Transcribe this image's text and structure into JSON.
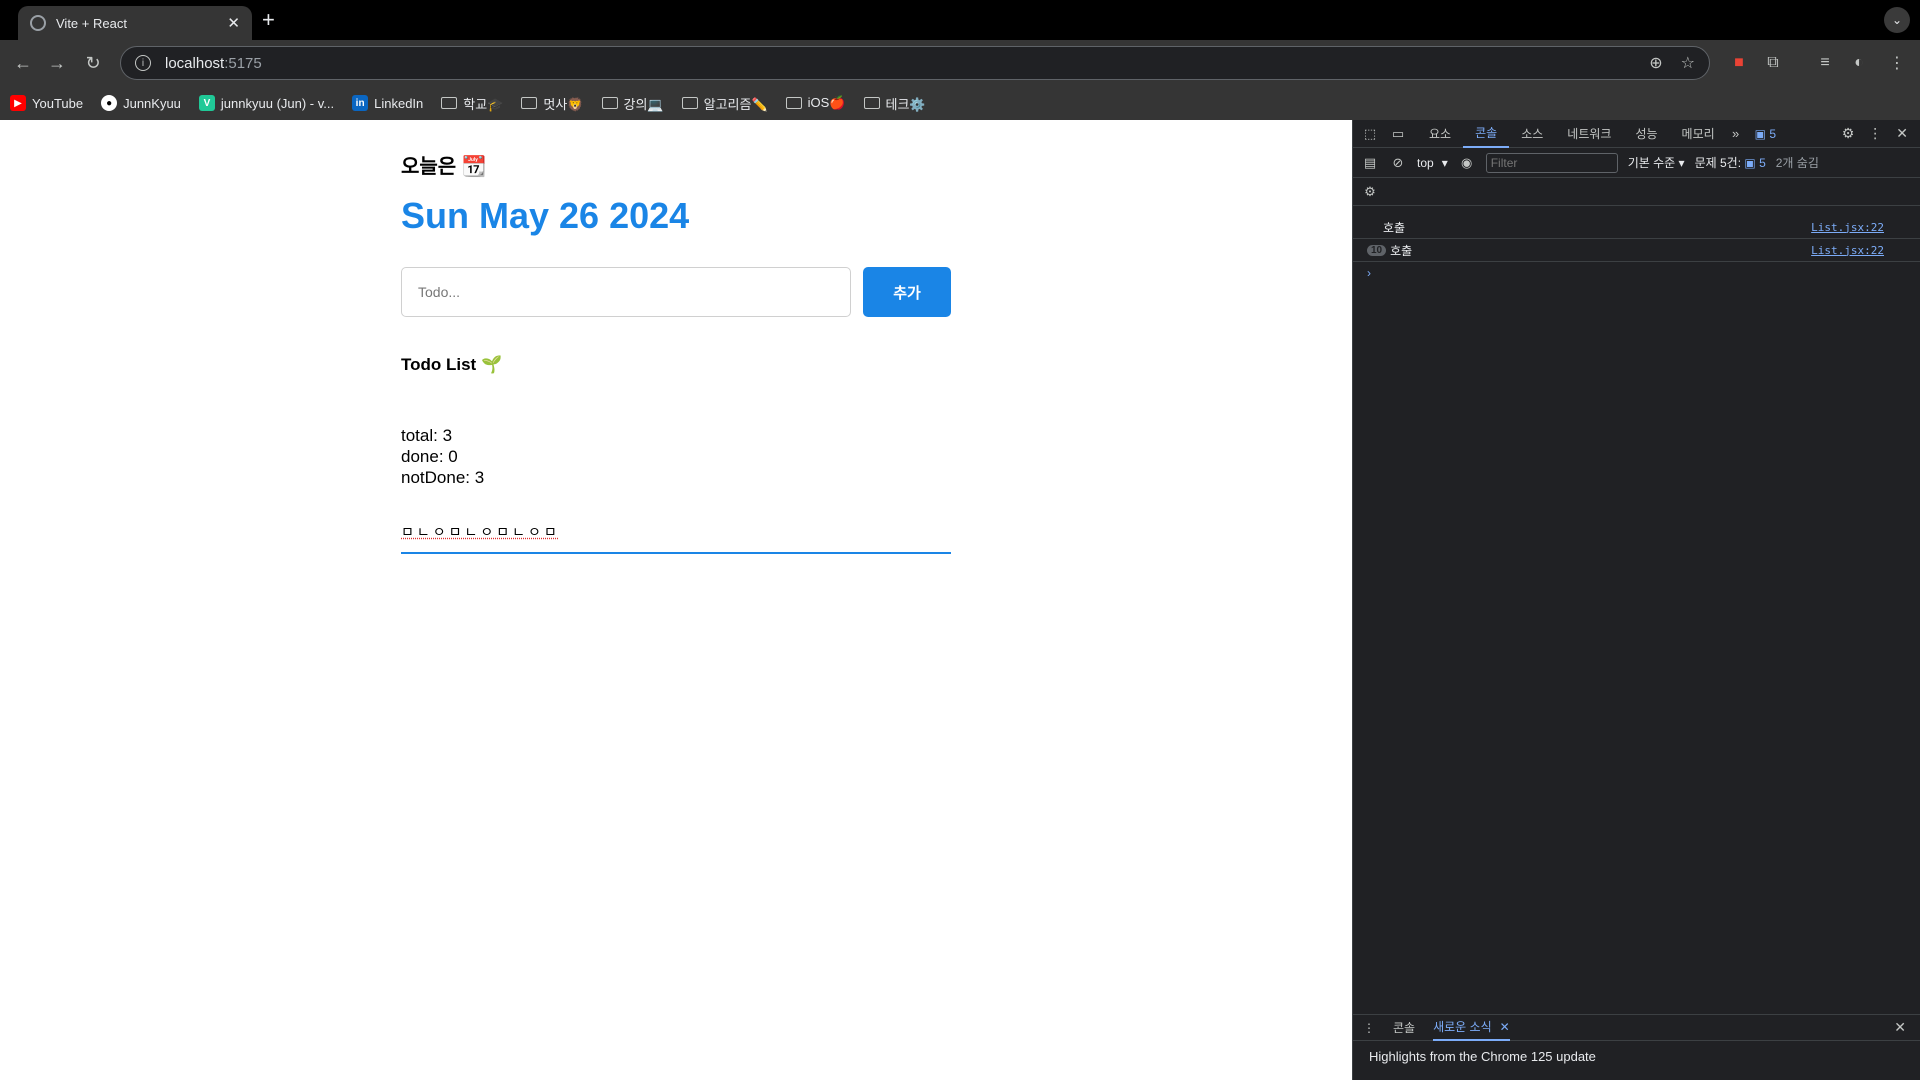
{
  "browser": {
    "tab_title": "Vite + React",
    "url_host": "localhost",
    "url_port": ":5175",
    "bookmarks": [
      {
        "label": "YouTube",
        "icon": "youtube-icon"
      },
      {
        "label": "JunnKyuu",
        "icon": "github-icon"
      },
      {
        "label": "junnkyuu (Jun) - v...",
        "icon": "velog-icon"
      },
      {
        "label": "LinkedIn",
        "icon": "linkedin-icon"
      },
      {
        "label": "학교🎓",
        "icon": "folder-icon"
      },
      {
        "label": "멋사🦁",
        "icon": "folder-icon"
      },
      {
        "label": "강의💻",
        "icon": "folder-icon"
      },
      {
        "label": "알고리즘✏️",
        "icon": "folder-icon"
      },
      {
        "label": "iOS🍎",
        "icon": "folder-icon"
      },
      {
        "label": "테크⚙️",
        "icon": "folder-icon"
      }
    ]
  },
  "app": {
    "today_label": "오늘은 📆",
    "date": "Sun May 26 2024",
    "todo_placeholder": "Todo...",
    "add_button": "추가",
    "list_title": "Todo List 🌱",
    "stats": {
      "total": "total: 3",
      "done": "done: 0",
      "not_done": "notDone: 3"
    },
    "search_value": "ㅁㄴㅇㅁㄴㅇㅁㄴㅇㅁ"
  },
  "devtools": {
    "tabs": [
      "요소",
      "콘솔",
      "소스",
      "네트워크",
      "성능",
      "메모리"
    ],
    "active_tab": "콘솔",
    "issues_badge": "5",
    "context": "top",
    "filter_placeholder": "Filter",
    "levels": "기본 수준",
    "issues_label": "문제 5건:",
    "issues_count": "5",
    "hidden": "2개 숨김",
    "logs": [
      {
        "message": "호출",
        "source": "List.jsx:22"
      },
      {
        "repeat": "10",
        "message": "호출",
        "source": "List.jsx:22"
      }
    ],
    "prompt": "›",
    "drawer": {
      "tab_console": "콘솔",
      "tab_news": "새로운 소식",
      "content": "Highlights from the Chrome 125 update"
    }
  },
  "colors": {
    "accent": "#1a85e6",
    "devtools_link": "#7cacf8"
  }
}
